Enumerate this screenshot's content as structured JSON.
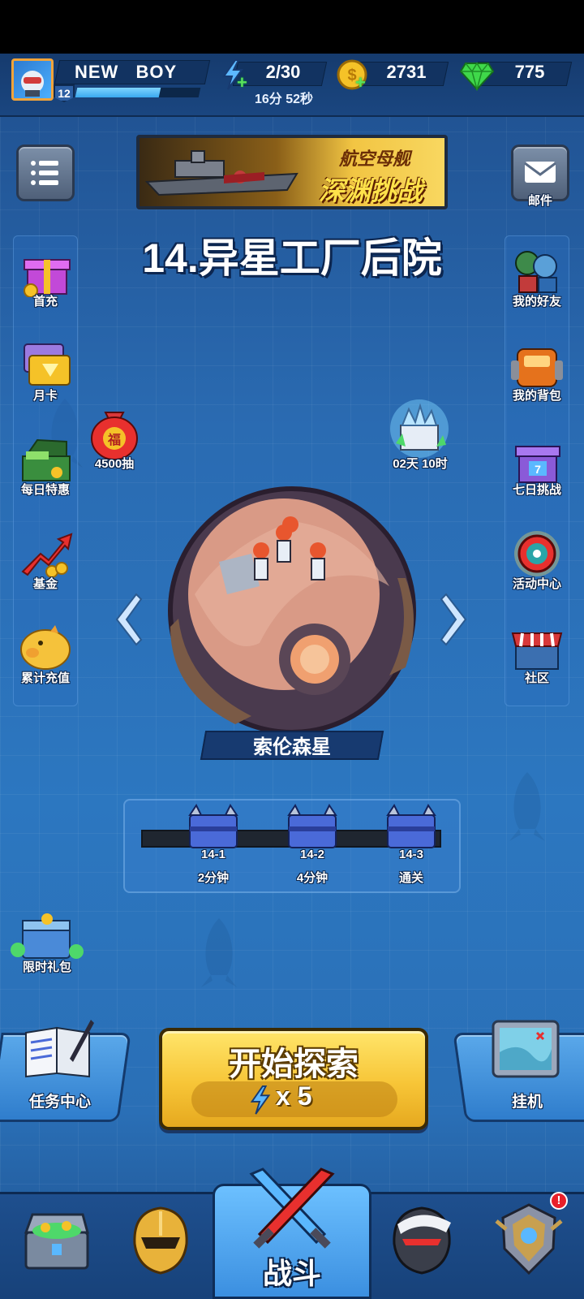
{
  "player": {
    "name": "NEW BOY",
    "level": "12",
    "xp_fraction": 0.68
  },
  "resources": {
    "energy": "2/30",
    "energy_timer": "16分 52秒",
    "gold": "2731",
    "gems": "775"
  },
  "banner": {
    "title": "航空母舰",
    "subtitle": "深渊挑战"
  },
  "top_right": {
    "mail_label": "邮件"
  },
  "stage": {
    "title": "14.异星工厂后院",
    "planet_name": "索伦森星"
  },
  "left_menu": [
    {
      "label": "首充",
      "icon": "gift-box-icon"
    },
    {
      "label": "月卡",
      "icon": "month-card-icon"
    },
    {
      "label": "每日特惠",
      "icon": "cash-chest-icon"
    },
    {
      "label": "基金",
      "icon": "growth-arrow-icon"
    },
    {
      "label": "累计充值",
      "icon": "piggy-bank-icon"
    }
  ],
  "right_menu": [
    {
      "label": "我的好友",
      "icon": "friends-icon"
    },
    {
      "label": "我的背包",
      "icon": "backpack-icon"
    },
    {
      "label": "七日挑战",
      "icon": "seven-day-gift-icon"
    },
    {
      "label": "活动中心",
      "icon": "activity-wheel-icon"
    },
    {
      "label": "社区",
      "icon": "shop-stall-icon"
    }
  ],
  "lucky_bag": {
    "label": "4500抽",
    "char": "福"
  },
  "crystal_event": {
    "label": "02天 10时"
  },
  "stage_rewards": [
    {
      "id": "14-1",
      "time": "2分钟"
    },
    {
      "id": "14-2",
      "time": "4分钟"
    },
    {
      "id": "14-3",
      "time": "通关"
    }
  ],
  "limited_pack": {
    "label": "限时礼包"
  },
  "actions": {
    "task_center": "任务中心",
    "start_label": "开始探索",
    "start_cost": "x 5",
    "idle": "挂机"
  },
  "bottom_nav": {
    "active_label": "战斗",
    "alert_mark": "!"
  },
  "colors": {
    "accent_gold": "#f7c537",
    "bg_blue": "#2a6bb2",
    "alert_red": "#e8202a"
  }
}
